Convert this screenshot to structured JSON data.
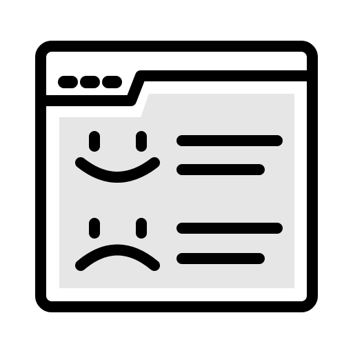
{
  "icon": {
    "name": "feedback-browser-window-icon",
    "colors": {
      "stroke": "#000000",
      "window_fill": "#ffffff",
      "panel_fill": "#e6e6e6"
    },
    "window_controls": {
      "dot_count": 3
    },
    "rows": [
      {
        "sentiment": "positive",
        "face_icon": "smiley-face-icon",
        "text_line_count": 2
      },
      {
        "sentiment": "negative",
        "face_icon": "sad-face-icon",
        "text_line_count": 2
      }
    ]
  }
}
